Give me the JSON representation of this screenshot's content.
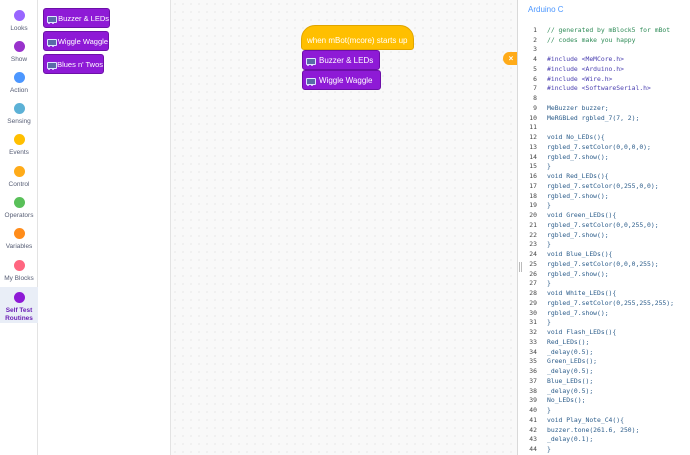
{
  "sidebar": {
    "categories": [
      {
        "label": "Looks",
        "color": "#9966ff"
      },
      {
        "label": "Show",
        "color": "#9932cc"
      },
      {
        "label": "Action",
        "color": "#4c97ff"
      },
      {
        "label": "Sensing",
        "color": "#5cb1d6"
      },
      {
        "label": "Events",
        "color": "#ffbf00"
      },
      {
        "label": "Control",
        "color": "#ffab19"
      },
      {
        "label": "Operators",
        "color": "#59c059"
      },
      {
        "label": "Variables",
        "color": "#ff8c1a"
      },
      {
        "label": "My Blocks",
        "color": "#ff6680"
      },
      {
        "label1": "Self Test",
        "label2": "Routines",
        "color": "#8e1ad6",
        "active": true
      }
    ]
  },
  "palette": {
    "blocks": [
      "Buzzer & LEDs",
      "Wiggle Waggle",
      "Blues n' Twos"
    ]
  },
  "workspace": {
    "hat_label": "when mBot(mcore) starts up",
    "stack": [
      "Buzzer & LEDs",
      "Wiggle Waggle"
    ]
  },
  "code_panel": {
    "title": "Arduino C",
    "collapse_icon": "×",
    "lines": [
      {
        "n": "1",
        "t": "// generated by mBlock5 for mBot",
        "k": "comment"
      },
      {
        "n": "2",
        "t": "// codes make you happy",
        "k": "comment"
      },
      {
        "n": "3",
        "t": "",
        "k": "code"
      },
      {
        "n": "4",
        "t": "#include <MeMCore.h>",
        "k": "include"
      },
      {
        "n": "5",
        "t": "#include <Arduino.h>",
        "k": "include"
      },
      {
        "n": "6",
        "t": "#include <Wire.h>",
        "k": "include"
      },
      {
        "n": "7",
        "t": "#include <SoftwareSerial.h>",
        "k": "include"
      },
      {
        "n": "8",
        "t": "",
        "k": "code"
      },
      {
        "n": "9",
        "t": "MeBuzzer buzzer;",
        "k": "code"
      },
      {
        "n": "10",
        "t": "MeRGBLed rgbled_7(7, 2);",
        "k": "code"
      },
      {
        "n": "11",
        "t": "",
        "k": "code"
      },
      {
        "n": "12",
        "t": "void No_LEDs(){",
        "k": "code"
      },
      {
        "n": "13",
        "t": "rgbled_7.setColor(0,0,0,0);",
        "k": "code"
      },
      {
        "n": "14",
        "t": "rgbled_7.show();",
        "k": "code"
      },
      {
        "n": "15",
        "t": "}",
        "k": "code"
      },
      {
        "n": "16",
        "t": "void Red_LEDs(){",
        "k": "code"
      },
      {
        "n": "17",
        "t": "rgbled_7.setColor(0,255,0,0);",
        "k": "code"
      },
      {
        "n": "18",
        "t": "rgbled_7.show();",
        "k": "code"
      },
      {
        "n": "19",
        "t": "}",
        "k": "code"
      },
      {
        "n": "20",
        "t": "void Green_LEDs(){",
        "k": "code"
      },
      {
        "n": "21",
        "t": "rgbled_7.setColor(0,0,255,0);",
        "k": "code"
      },
      {
        "n": "22",
        "t": "rgbled_7.show();",
        "k": "code"
      },
      {
        "n": "23",
        "t": "}",
        "k": "code"
      },
      {
        "n": "24",
        "t": "void Blue_LEDs(){",
        "k": "code"
      },
      {
        "n": "25",
        "t": "rgbled_7.setColor(0,0,0,255);",
        "k": "code"
      },
      {
        "n": "26",
        "t": "rgbled_7.show();",
        "k": "code"
      },
      {
        "n": "27",
        "t": "}",
        "k": "code"
      },
      {
        "n": "28",
        "t": "void White_LEDs(){",
        "k": "code"
      },
      {
        "n": "29",
        "t": "rgbled_7.setColor(0,255,255,255);",
        "k": "code"
      },
      {
        "n": "30",
        "t": "rgbled_7.show();",
        "k": "code"
      },
      {
        "n": "31",
        "t": "}",
        "k": "code"
      },
      {
        "n": "32",
        "t": "void Flash_LEDs(){",
        "k": "code"
      },
      {
        "n": "33",
        "t": "Red_LEDs();",
        "k": "code"
      },
      {
        "n": "34",
        "t": "_delay(0.5);",
        "k": "code"
      },
      {
        "n": "35",
        "t": "Green_LEDs();",
        "k": "code"
      },
      {
        "n": "36",
        "t": "_delay(0.5);",
        "k": "code"
      },
      {
        "n": "37",
        "t": "Blue_LEDs();",
        "k": "code"
      },
      {
        "n": "38",
        "t": "_delay(0.5);",
        "k": "code"
      },
      {
        "n": "39",
        "t": "No_LEDs();",
        "k": "code"
      },
      {
        "n": "40",
        "t": "}",
        "k": "code"
      },
      {
        "n": "41",
        "t": "void Play_Note_C4(){",
        "k": "code"
      },
      {
        "n": "42",
        "t": "buzzer.tone(261.6, 250);",
        "k": "code"
      },
      {
        "n": "43",
        "t": "_delay(0.1);",
        "k": "code"
      },
      {
        "n": "44",
        "t": "}",
        "k": "code"
      }
    ]
  }
}
